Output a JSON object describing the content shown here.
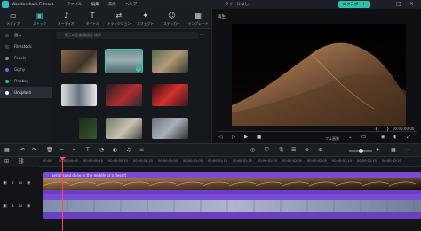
{
  "app": {
    "title": "Wondershare Filmora",
    "menus": [
      "ファイル",
      "編集",
      "表示",
      "ヘルプ"
    ],
    "project_title": "タイトルなし",
    "export_label": "エクスポート"
  },
  "toolbar": {
    "tabs": [
      {
        "label": "メディア",
        "icon": "folder-icon"
      },
      {
        "label": "ストック",
        "icon": "stock-icon",
        "active": true
      },
      {
        "label": "オーディオ",
        "icon": "music-icon"
      },
      {
        "label": "タイトル",
        "icon": "text-icon"
      },
      {
        "label": "トランジション",
        "icon": "transition-icon"
      },
      {
        "label": "エフェクト",
        "icon": "effects-icon"
      },
      {
        "label": "ステッカー",
        "icon": "sticker-icon"
      },
      {
        "label": "テンプレート",
        "icon": "template-icon"
      }
    ]
  },
  "sidebar": {
    "items": [
      {
        "label": "個人"
      },
      {
        "label": "Filmstock"
      },
      {
        "label": "Pexels",
        "color": "#39b36b"
      },
      {
        "label": "Giphy",
        "color": "#8a5cf6"
      },
      {
        "label": "Pixabay",
        "color": "#2ec27e"
      },
      {
        "label": "Unsplash",
        "color": "#ffffff",
        "active": true
      }
    ]
  },
  "library": {
    "search_placeholder": "例示の画像/動画を検索",
    "selected_index": 1
  },
  "preview": {
    "title": "再生",
    "current_time": "00:00:00:00",
    "quality": "フル画質"
  },
  "timeline": {
    "ruler_ticks": [
      "00:00",
      "00:00:00:05",
      "00:00:00:10",
      "00:00:00:15",
      "00:00:00:20",
      "00:00:01:00",
      "00:00:01:05",
      "00:00:01:10",
      "00:00:01:15",
      "00:00:01:20",
      "00:00:02:00",
      "00:00:02:05",
      "00:00:02:10",
      "00:00:02:15",
      "00:00:02:20"
    ],
    "video_clip_name": "aerial sand dune in the middle of a desert",
    "tracks": [
      {
        "label": "2"
      },
      {
        "label": "1"
      }
    ]
  },
  "colors": {
    "accent": "#2fd0b8",
    "clip": "#7a4cd6",
    "playhead": "#ff4b4b"
  }
}
